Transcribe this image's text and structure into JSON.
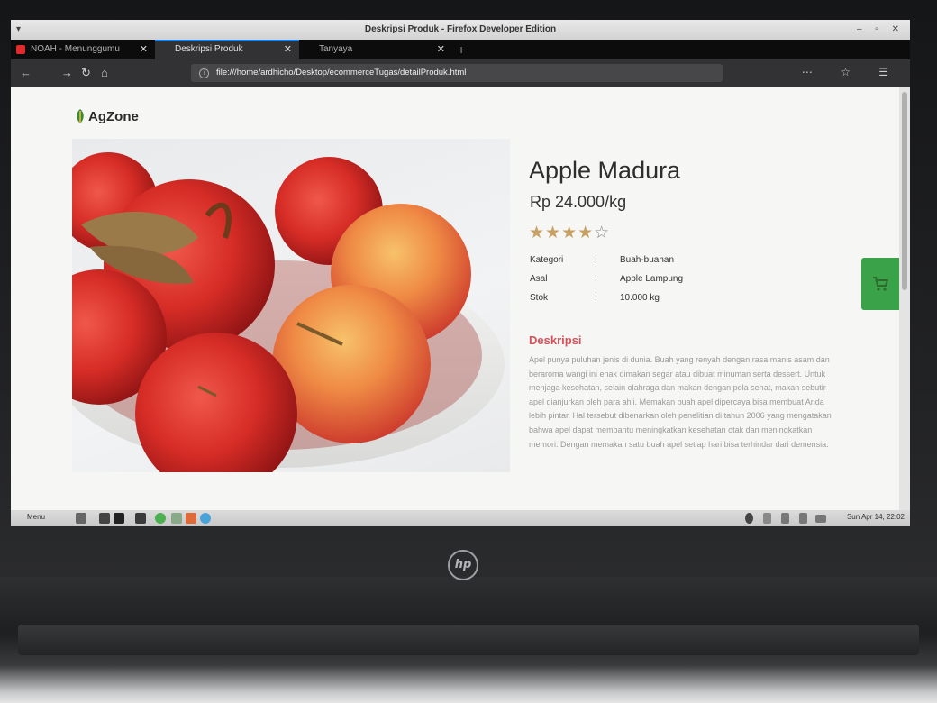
{
  "window": {
    "title": "Deskripsi Produk - Firefox Developer Edition",
    "controls": "– ▫ ✕"
  },
  "tabs": [
    {
      "label": "NOAH - Menunggumu",
      "active": false
    },
    {
      "label": "Deskripsi Produk",
      "active": true
    },
    {
      "label": "Tanyaya",
      "active": false
    }
  ],
  "navbar": {
    "url": "file:///home/ardhicho/Desktop/ecommerceTugas/detailProduk.html"
  },
  "brand": {
    "name": "AgZone"
  },
  "product": {
    "title": "Apple Madura",
    "price": "Rp 24.000/kg",
    "rating": 4,
    "rating_max": 5,
    "stars_filled": "★★★★",
    "stars_empty": "☆",
    "specs": [
      {
        "key": "Kategori",
        "value": "Buah-buahan"
      },
      {
        "key": "Asal",
        "value": "Apple Lampung"
      },
      {
        "key": "Stok",
        "value": "10.000 kg"
      }
    ],
    "description_heading": "Deskripsi",
    "description": "Apel punya puluhan jenis di dunia. Buah yang renyah dengan rasa manis asam dan beraroma wangi ini enak dimakan segar atau dibuat minuman serta dessert. Untuk menjaga kesehatan, selain olahraga dan makan dengan pola sehat, makan sebutir apel dianjurkan oleh para ahli. Memakan buah apel dipercaya bisa membuat Anda lebih pintar. Hal tersebut dibenarkan oleh penelitian di tahun 2006 yang mengatakan bahwa apel dapat membantu meningkatkan kesehatan otak dan meningkatkan memori. Dengan memakan satu buah apel setiap hari bisa terhindar dari demensia."
  },
  "taskbar": {
    "menu_label": "Menu",
    "clock": "Sun Apr 14, 22:02"
  },
  "colors": {
    "accent_red": "#d7515b",
    "cart_green": "#3aa34a",
    "star": "#c8a063"
  },
  "laptop": {
    "brand": "hp"
  }
}
